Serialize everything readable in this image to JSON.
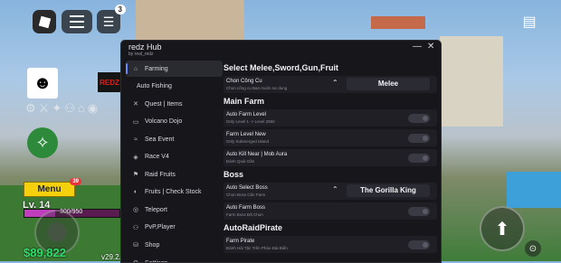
{
  "hud": {
    "chat_badge": "3",
    "redz_logo_text": "REDZ",
    "menu_label": "Menu",
    "menu_badge": "39",
    "level": "Lv. 14",
    "hp_text": "300/950",
    "hp_fraction": 0.32,
    "money": "$89,822",
    "version": "v29.2."
  },
  "panel": {
    "title": "redz Hub",
    "author": "by real_redz",
    "minimize": "—",
    "close": "✕"
  },
  "sidebar": {
    "items": [
      {
        "label": "Farming",
        "icon": "home-icon",
        "glyph": "⌂",
        "active": true
      },
      {
        "label": "Auto Fishing",
        "icon": "",
        "glyph": "",
        "active": false
      },
      {
        "label": "Quest | Items",
        "icon": "swords-icon",
        "glyph": "✕",
        "active": false
      },
      {
        "label": "Volcano Dojo",
        "icon": "dojo-icon",
        "glyph": "▭",
        "active": false
      },
      {
        "label": "Sea Event",
        "icon": "wave-icon",
        "glyph": "≈",
        "active": false
      },
      {
        "label": "Race V4",
        "icon": "race-icon",
        "glyph": "◈",
        "active": false
      },
      {
        "label": "Raid Fruits",
        "icon": "raid-icon",
        "glyph": "⚑",
        "active": false
      },
      {
        "label": "Fruits | Check Stock",
        "icon": "fruit-icon",
        "glyph": "◐",
        "active": false
      },
      {
        "label": "Teleport",
        "icon": "teleport-icon",
        "glyph": "◎",
        "active": false
      },
      {
        "label": "PvP,Player",
        "icon": "pvp-icon",
        "glyph": "⚇",
        "active": false
      },
      {
        "label": "Shop",
        "icon": "shop-icon",
        "glyph": "⛁",
        "active": false
      },
      {
        "label": "Settings",
        "icon": "gear-icon",
        "glyph": "⚙",
        "active": false
      }
    ]
  },
  "content": {
    "sections": [
      {
        "title": "Select Melee,Sword,Gun,Fruit"
      },
      {
        "title": "Main Farm"
      },
      {
        "title": "Boss"
      },
      {
        "title": "AutoRaidPirate"
      }
    ],
    "weapon_dropdown": {
      "title": "Chon Công Cu",
      "desc": "Chon công cu Ban muôn sư dung",
      "value": "Melee"
    },
    "farm_level": {
      "title": "Auto Farm Level",
      "desc": "Only Level 1 -> Level 2650"
    },
    "farm_level_new": {
      "title": "Farm Level New",
      "desc": "Only Submerged Island"
    },
    "kill_near": {
      "title": "Auto Kill Near | Mob Aura",
      "desc": "Đánh Quái Gần"
    },
    "boss_dropdown": {
      "title": "Auto Select Boss",
      "desc": "Chon Boss Cân Farm",
      "value": "The Gorilla King"
    },
    "farm_boss": {
      "title": "Auto Farm Boss",
      "desc": "Farm Boss Đã Chon"
    },
    "farm_pirate": {
      "title": "Farm Pirate",
      "desc": "Đánh Hải Tặc Trên Pháo Đài Biển"
    }
  }
}
